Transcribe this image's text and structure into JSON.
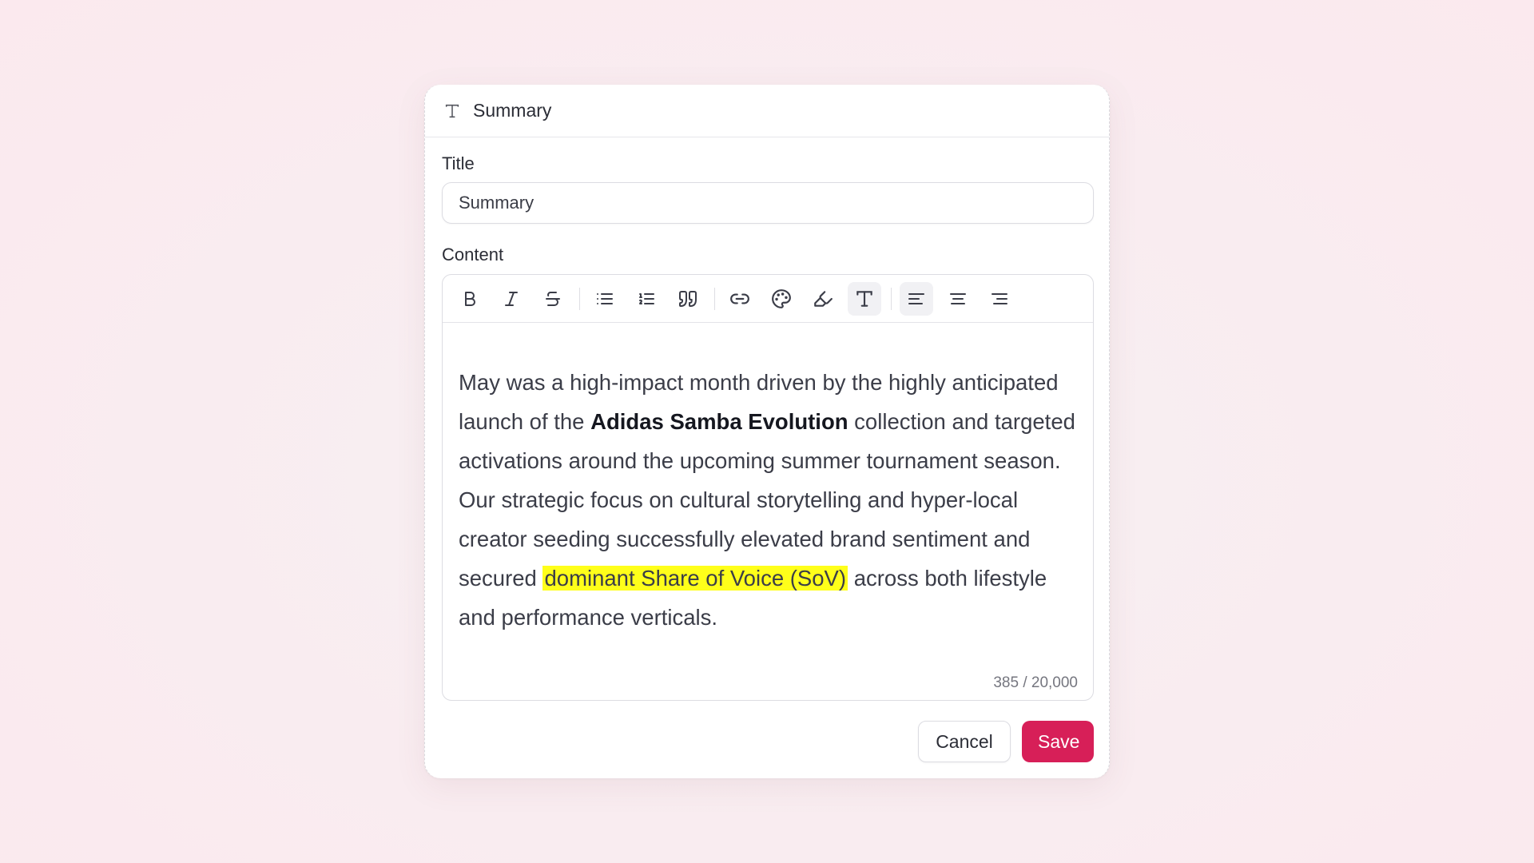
{
  "modal": {
    "header_title": "Summary",
    "header_icon": "text-type-icon"
  },
  "title_field": {
    "label": "Title",
    "value": "Summary"
  },
  "content_field": {
    "label": "Content",
    "toolbar": [
      {
        "name": "bold",
        "icon": "bold-icon"
      },
      {
        "name": "italic",
        "icon": "italic-icon"
      },
      {
        "name": "strikethrough",
        "icon": "strikethrough-icon"
      },
      {
        "name": "bullet-list",
        "icon": "bullet-list-icon"
      },
      {
        "name": "ordered-list",
        "icon": "ordered-list-icon"
      },
      {
        "name": "quote",
        "icon": "quote-icon"
      },
      {
        "name": "link",
        "icon": "link-icon"
      },
      {
        "name": "text-color",
        "icon": "palette-icon"
      },
      {
        "name": "highlight",
        "icon": "highlighter-icon"
      },
      {
        "name": "text-style",
        "icon": "text-type-icon",
        "active": true
      },
      {
        "name": "align-left",
        "icon": "align-left-icon",
        "active": true
      },
      {
        "name": "align-center",
        "icon": "align-center-icon"
      },
      {
        "name": "align-right",
        "icon": "align-right-icon"
      }
    ],
    "body": {
      "seg1": "May was a high-impact month driven by the highly anticipated launch of the ",
      "bold": "Adidas Samba Evolution",
      "seg2": " collection and targeted activations around the upcoming summer tournament season. Our strategic focus on cultural storytelling and hyper-local creator seeding successfully elevated brand sentiment and secured ",
      "highlight": "dominant Share of Voice (SoV)",
      "seg3": " across both lifestyle and performance verticals."
    },
    "counter": "385 / 20,000"
  },
  "actions": {
    "cancel_label": "Cancel",
    "save_label": "Save"
  },
  "colors": {
    "accent": "#d71f58",
    "highlight": "#ffff1a",
    "background": "#f9ecf0"
  }
}
